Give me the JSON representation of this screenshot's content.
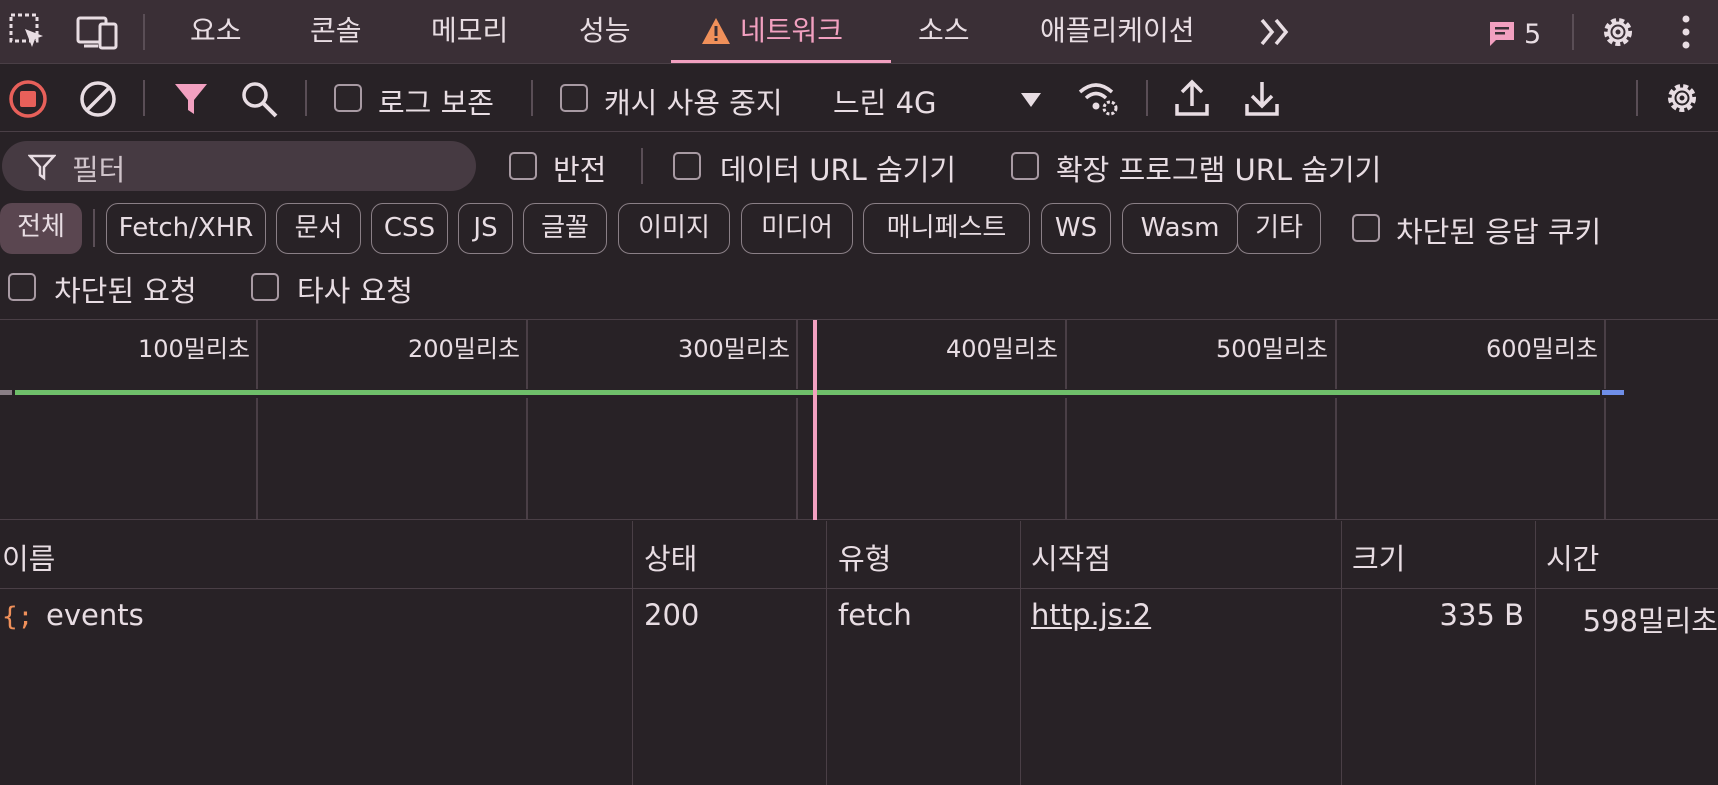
{
  "tabs": {
    "elements": "요소",
    "console": "콘솔",
    "memory": "메모리",
    "performance": "성능",
    "network": "네트워크",
    "sources": "소스",
    "application": "애플리케이션",
    "messages_count": "5"
  },
  "toolbar": {
    "preserve_log": "로그 보존",
    "disable_cache": "캐시 사용 중지",
    "throttling": "느린 4G"
  },
  "filter": {
    "placeholder": "필터",
    "invert": "반전",
    "hide_data_urls": "데이터 URL 숨기기",
    "hide_extension_urls": "확장 프로그램 URL 숨기기",
    "blocked_response_cookies": "차단된 응답 쿠키",
    "blocked_requests": "차단된 요청",
    "third_party_requests": "타사 요청"
  },
  "chips": [
    "전체",
    "Fetch/XHR",
    "문서",
    "CSS",
    "JS",
    "글꼴",
    "이미지",
    "미디어",
    "매니페스트",
    "WS",
    "Wasm",
    "기타"
  ],
  "timeline": {
    "ticks": [
      "100밀리초",
      "200밀리초",
      "300밀리초",
      "400밀리초",
      "500밀리초",
      "600밀리초"
    ]
  },
  "table": {
    "headers": {
      "name": "이름",
      "status": "상태",
      "type": "유형",
      "initiator": "시작점",
      "size": "크기",
      "time": "시간"
    },
    "rows": [
      {
        "name": "events",
        "status": "200",
        "type": "fetch",
        "initiator": "http.js:2",
        "size": "335 B",
        "time": "598밀리초"
      }
    ]
  },
  "colors": {
    "accent": "#f2a0c0",
    "record": "#e8605a",
    "warning": "#f0905a",
    "waterfall_green": "#6fbf6a",
    "waterfall_blue": "#6f8ee8"
  }
}
